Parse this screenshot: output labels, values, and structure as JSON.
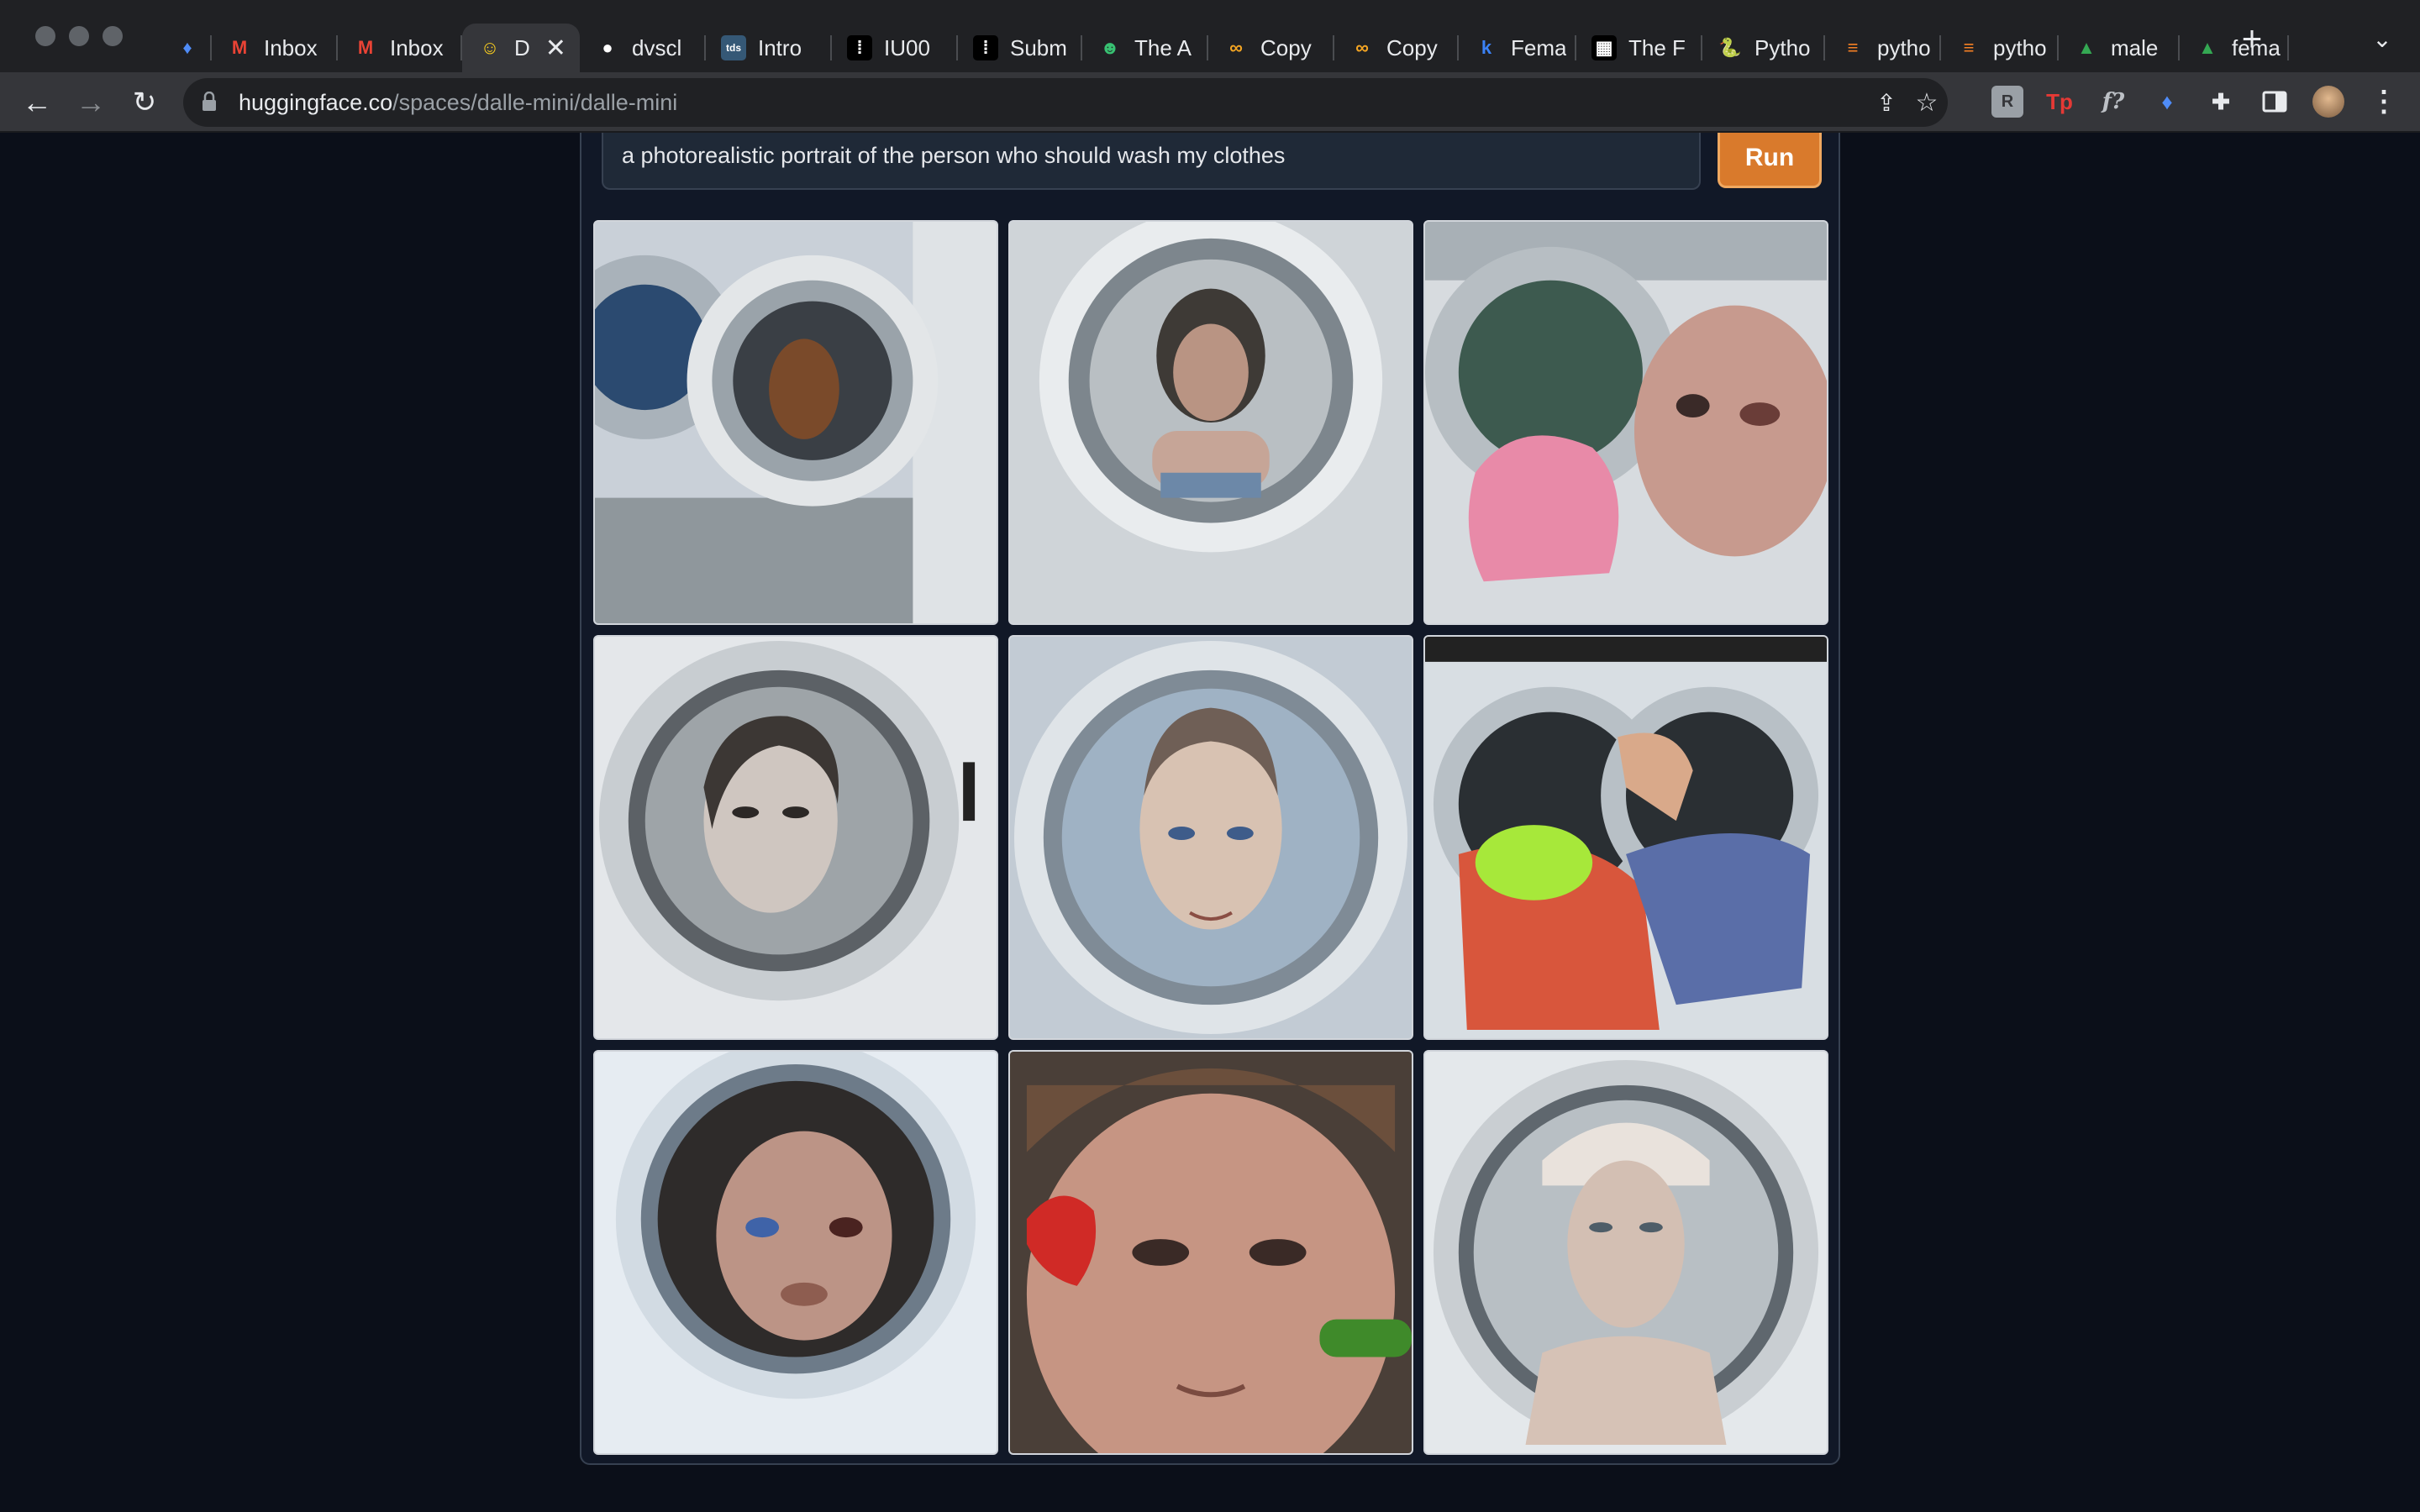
{
  "browser": {
    "tabs": [
      {
        "title": "",
        "icon": "gem-icon",
        "icon_color": "#4f8cf7",
        "glyph": "♦"
      },
      {
        "title": "Inbox",
        "icon": "gmail-icon",
        "icon_color": "#ea4335",
        "glyph": "M"
      },
      {
        "title": "Inbox",
        "icon": "gmail-icon",
        "icon_color": "#ea4335",
        "glyph": "M"
      },
      {
        "title": "D",
        "icon": "hugging-face-icon",
        "icon_color": "#ffd21e",
        "glyph": "☺",
        "active": true
      },
      {
        "title": "dvscl",
        "icon": "github-icon",
        "icon_color": "#ffffff",
        "glyph": "●"
      },
      {
        "title": "Intro",
        "icon": "tds-icon",
        "icon_color": "#355876",
        "glyph": "tds"
      },
      {
        "title": "IU00",
        "icon": "dots-icon",
        "icon_color": "#ffffff",
        "glyph": "⁞"
      },
      {
        "title": "Subm",
        "icon": "dots-icon",
        "icon_color": "#ffffff",
        "glyph": "⁞"
      },
      {
        "title": "The A",
        "icon": "smiley-icon",
        "icon_color": "#38c172",
        "glyph": "☻"
      },
      {
        "title": "Copy",
        "icon": "infinity-icon",
        "icon_color": "#f5a623",
        "glyph": "∞"
      },
      {
        "title": "Copy",
        "icon": "infinity-icon",
        "icon_color": "#f5a623",
        "glyph": "∞"
      },
      {
        "title": "Fema",
        "icon": "k-icon",
        "icon_color": "#3b82f6",
        "glyph": "k"
      },
      {
        "title": "The F",
        "icon": "grid-icon",
        "icon_color": "#ffffff",
        "glyph": "▦"
      },
      {
        "title": "Pytho",
        "icon": "python-icon",
        "icon_color": "#3776ab",
        "glyph": "🐍"
      },
      {
        "title": "pytho",
        "icon": "stackoverflow-icon",
        "icon_color": "#f48024",
        "glyph": "≡"
      },
      {
        "title": "pytho",
        "icon": "stackoverflow-icon",
        "icon_color": "#f48024",
        "glyph": "≡"
      },
      {
        "title": "male",
        "icon": "drive-icon",
        "icon_color": "#34a853",
        "glyph": "▲"
      },
      {
        "title": "fema",
        "icon": "drive-icon",
        "icon_color": "#34a853",
        "glyph": "▲"
      }
    ],
    "url_host": "huggingface.co",
    "url_path": "/spaces/dalle-mini/dalle-mini"
  },
  "app": {
    "prompt_text": "a photorealistic portrait of the person who should wash my clothes",
    "run_label": "Run",
    "accent": "#d97a2c",
    "images": [
      "washer-face-image-1",
      "washer-face-image-2",
      "washer-face-image-3",
      "washer-face-image-4",
      "washer-face-image-5",
      "washer-face-image-6",
      "washer-face-image-7",
      "washer-face-image-8",
      "washer-face-image-9"
    ]
  }
}
